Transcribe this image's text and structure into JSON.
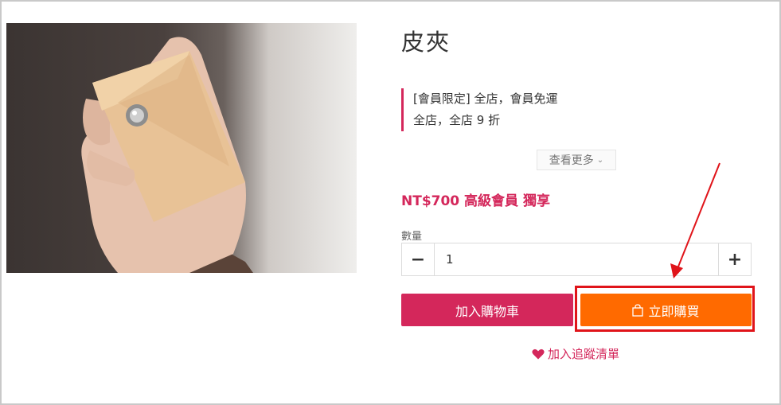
{
  "product": {
    "title": "皮夾",
    "promotions": [
      "[會員限定] 全店，會員免運",
      "全店，全店 9 折"
    ],
    "view_more_label": "查看更多",
    "price_text": "NT$700 高級會員 獨享",
    "image_icon": "wallet-in-hand-photo"
  },
  "quantity": {
    "label": "數量",
    "value": "1",
    "minus_icon": "minus-icon",
    "plus_icon": "plus-icon"
  },
  "actions": {
    "add_to_cart_label": "加入購物車",
    "buy_now_label": "立即購買",
    "buy_now_icon": "shopping-bag-icon",
    "wishlist_label": "加入追蹤清單",
    "wishlist_icon": "heart-icon"
  },
  "colors": {
    "brand": "#d4275b",
    "buy_now": "#ff6a00",
    "annotation": "#e0141a"
  }
}
